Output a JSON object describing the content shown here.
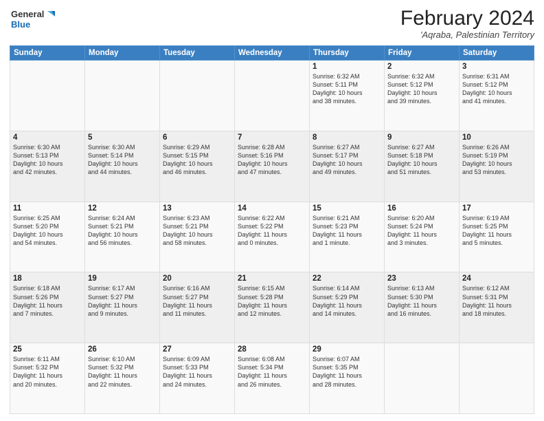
{
  "logo": {
    "line1": "General",
    "line2": "Blue"
  },
  "title": "February 2024",
  "subtitle": "'Aqraba, Palestinian Territory",
  "days_of_week": [
    "Sunday",
    "Monday",
    "Tuesday",
    "Wednesday",
    "Thursday",
    "Friday",
    "Saturday"
  ],
  "weeks": [
    [
      {
        "day": "",
        "info": ""
      },
      {
        "day": "",
        "info": ""
      },
      {
        "day": "",
        "info": ""
      },
      {
        "day": "",
        "info": ""
      },
      {
        "day": "1",
        "info": "Sunrise: 6:32 AM\nSunset: 5:11 PM\nDaylight: 10 hours\nand 38 minutes."
      },
      {
        "day": "2",
        "info": "Sunrise: 6:32 AM\nSunset: 5:12 PM\nDaylight: 10 hours\nand 39 minutes."
      },
      {
        "day": "3",
        "info": "Sunrise: 6:31 AM\nSunset: 5:12 PM\nDaylight: 10 hours\nand 41 minutes."
      }
    ],
    [
      {
        "day": "4",
        "info": "Sunrise: 6:30 AM\nSunset: 5:13 PM\nDaylight: 10 hours\nand 42 minutes."
      },
      {
        "day": "5",
        "info": "Sunrise: 6:30 AM\nSunset: 5:14 PM\nDaylight: 10 hours\nand 44 minutes."
      },
      {
        "day": "6",
        "info": "Sunrise: 6:29 AM\nSunset: 5:15 PM\nDaylight: 10 hours\nand 46 minutes."
      },
      {
        "day": "7",
        "info": "Sunrise: 6:28 AM\nSunset: 5:16 PM\nDaylight: 10 hours\nand 47 minutes."
      },
      {
        "day": "8",
        "info": "Sunrise: 6:27 AM\nSunset: 5:17 PM\nDaylight: 10 hours\nand 49 minutes."
      },
      {
        "day": "9",
        "info": "Sunrise: 6:27 AM\nSunset: 5:18 PM\nDaylight: 10 hours\nand 51 minutes."
      },
      {
        "day": "10",
        "info": "Sunrise: 6:26 AM\nSunset: 5:19 PM\nDaylight: 10 hours\nand 53 minutes."
      }
    ],
    [
      {
        "day": "11",
        "info": "Sunrise: 6:25 AM\nSunset: 5:20 PM\nDaylight: 10 hours\nand 54 minutes."
      },
      {
        "day": "12",
        "info": "Sunrise: 6:24 AM\nSunset: 5:21 PM\nDaylight: 10 hours\nand 56 minutes."
      },
      {
        "day": "13",
        "info": "Sunrise: 6:23 AM\nSunset: 5:21 PM\nDaylight: 10 hours\nand 58 minutes."
      },
      {
        "day": "14",
        "info": "Sunrise: 6:22 AM\nSunset: 5:22 PM\nDaylight: 11 hours\nand 0 minutes."
      },
      {
        "day": "15",
        "info": "Sunrise: 6:21 AM\nSunset: 5:23 PM\nDaylight: 11 hours\nand 1 minute."
      },
      {
        "day": "16",
        "info": "Sunrise: 6:20 AM\nSunset: 5:24 PM\nDaylight: 11 hours\nand 3 minutes."
      },
      {
        "day": "17",
        "info": "Sunrise: 6:19 AM\nSunset: 5:25 PM\nDaylight: 11 hours\nand 5 minutes."
      }
    ],
    [
      {
        "day": "18",
        "info": "Sunrise: 6:18 AM\nSunset: 5:26 PM\nDaylight: 11 hours\nand 7 minutes."
      },
      {
        "day": "19",
        "info": "Sunrise: 6:17 AM\nSunset: 5:27 PM\nDaylight: 11 hours\nand 9 minutes."
      },
      {
        "day": "20",
        "info": "Sunrise: 6:16 AM\nSunset: 5:27 PM\nDaylight: 11 hours\nand 11 minutes."
      },
      {
        "day": "21",
        "info": "Sunrise: 6:15 AM\nSunset: 5:28 PM\nDaylight: 11 hours\nand 12 minutes."
      },
      {
        "day": "22",
        "info": "Sunrise: 6:14 AM\nSunset: 5:29 PM\nDaylight: 11 hours\nand 14 minutes."
      },
      {
        "day": "23",
        "info": "Sunrise: 6:13 AM\nSunset: 5:30 PM\nDaylight: 11 hours\nand 16 minutes."
      },
      {
        "day": "24",
        "info": "Sunrise: 6:12 AM\nSunset: 5:31 PM\nDaylight: 11 hours\nand 18 minutes."
      }
    ],
    [
      {
        "day": "25",
        "info": "Sunrise: 6:11 AM\nSunset: 5:32 PM\nDaylight: 11 hours\nand 20 minutes."
      },
      {
        "day": "26",
        "info": "Sunrise: 6:10 AM\nSunset: 5:32 PM\nDaylight: 11 hours\nand 22 minutes."
      },
      {
        "day": "27",
        "info": "Sunrise: 6:09 AM\nSunset: 5:33 PM\nDaylight: 11 hours\nand 24 minutes."
      },
      {
        "day": "28",
        "info": "Sunrise: 6:08 AM\nSunset: 5:34 PM\nDaylight: 11 hours\nand 26 minutes."
      },
      {
        "day": "29",
        "info": "Sunrise: 6:07 AM\nSunset: 5:35 PM\nDaylight: 11 hours\nand 28 minutes."
      },
      {
        "day": "",
        "info": ""
      },
      {
        "day": "",
        "info": ""
      }
    ]
  ]
}
